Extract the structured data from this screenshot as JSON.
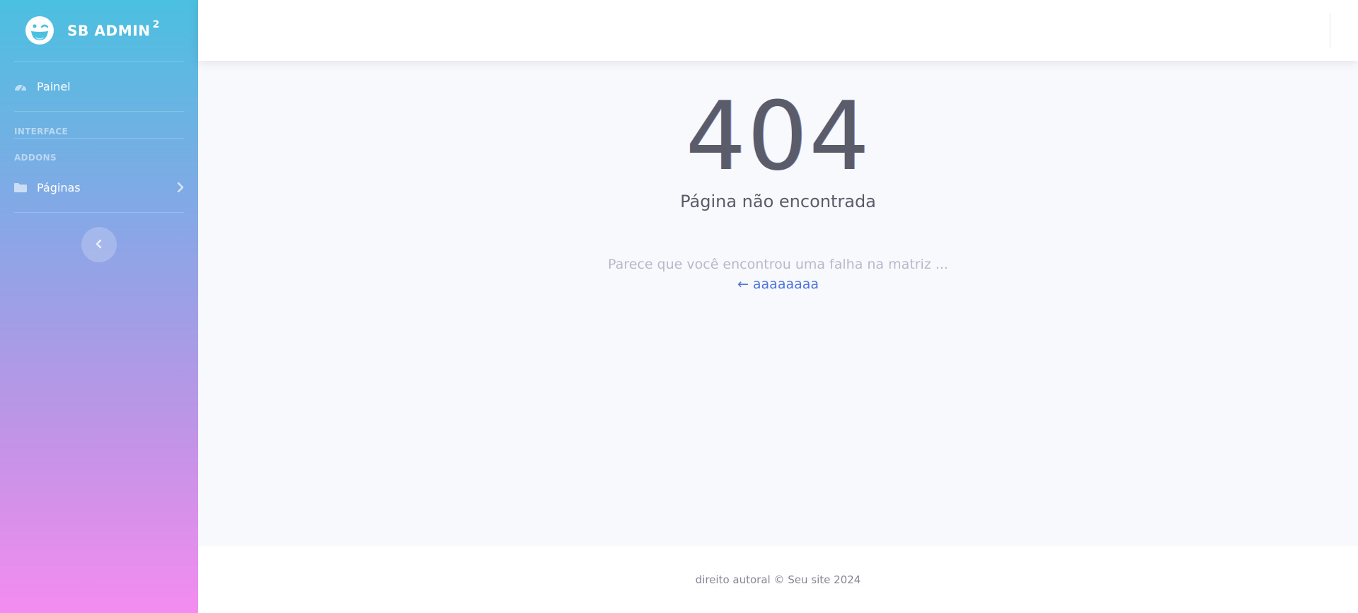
{
  "brand": {
    "name": "SB ADMIN",
    "superscript": "2",
    "icon": "laugh-wink-icon"
  },
  "sidebar": {
    "items": [
      {
        "label": "Painel",
        "icon": "tachometer-icon"
      },
      {
        "label": "Páginas",
        "icon": "folder-icon",
        "chevron": "chevron-right-icon"
      }
    ],
    "headings": [
      "INTERFACE",
      "ADDONS"
    ],
    "toggle_icon": "chevron-left-icon"
  },
  "error": {
    "code": "404",
    "title": "Página não encontrada",
    "message": "Parece que você encontrou uma falha na matriz ...",
    "back_link": "← aaaaaaaa"
  },
  "footer": {
    "text": "direito autoral © Seu site 2024"
  },
  "colors": {
    "sidebar_gradient_top": "#4bc0e0",
    "sidebar_gradient_bottom": "#f48cf0",
    "text_dark": "#5a5c69",
    "text_muted": "#b7b9cc",
    "link": "#4e73df",
    "background": "#f8f9fc"
  }
}
